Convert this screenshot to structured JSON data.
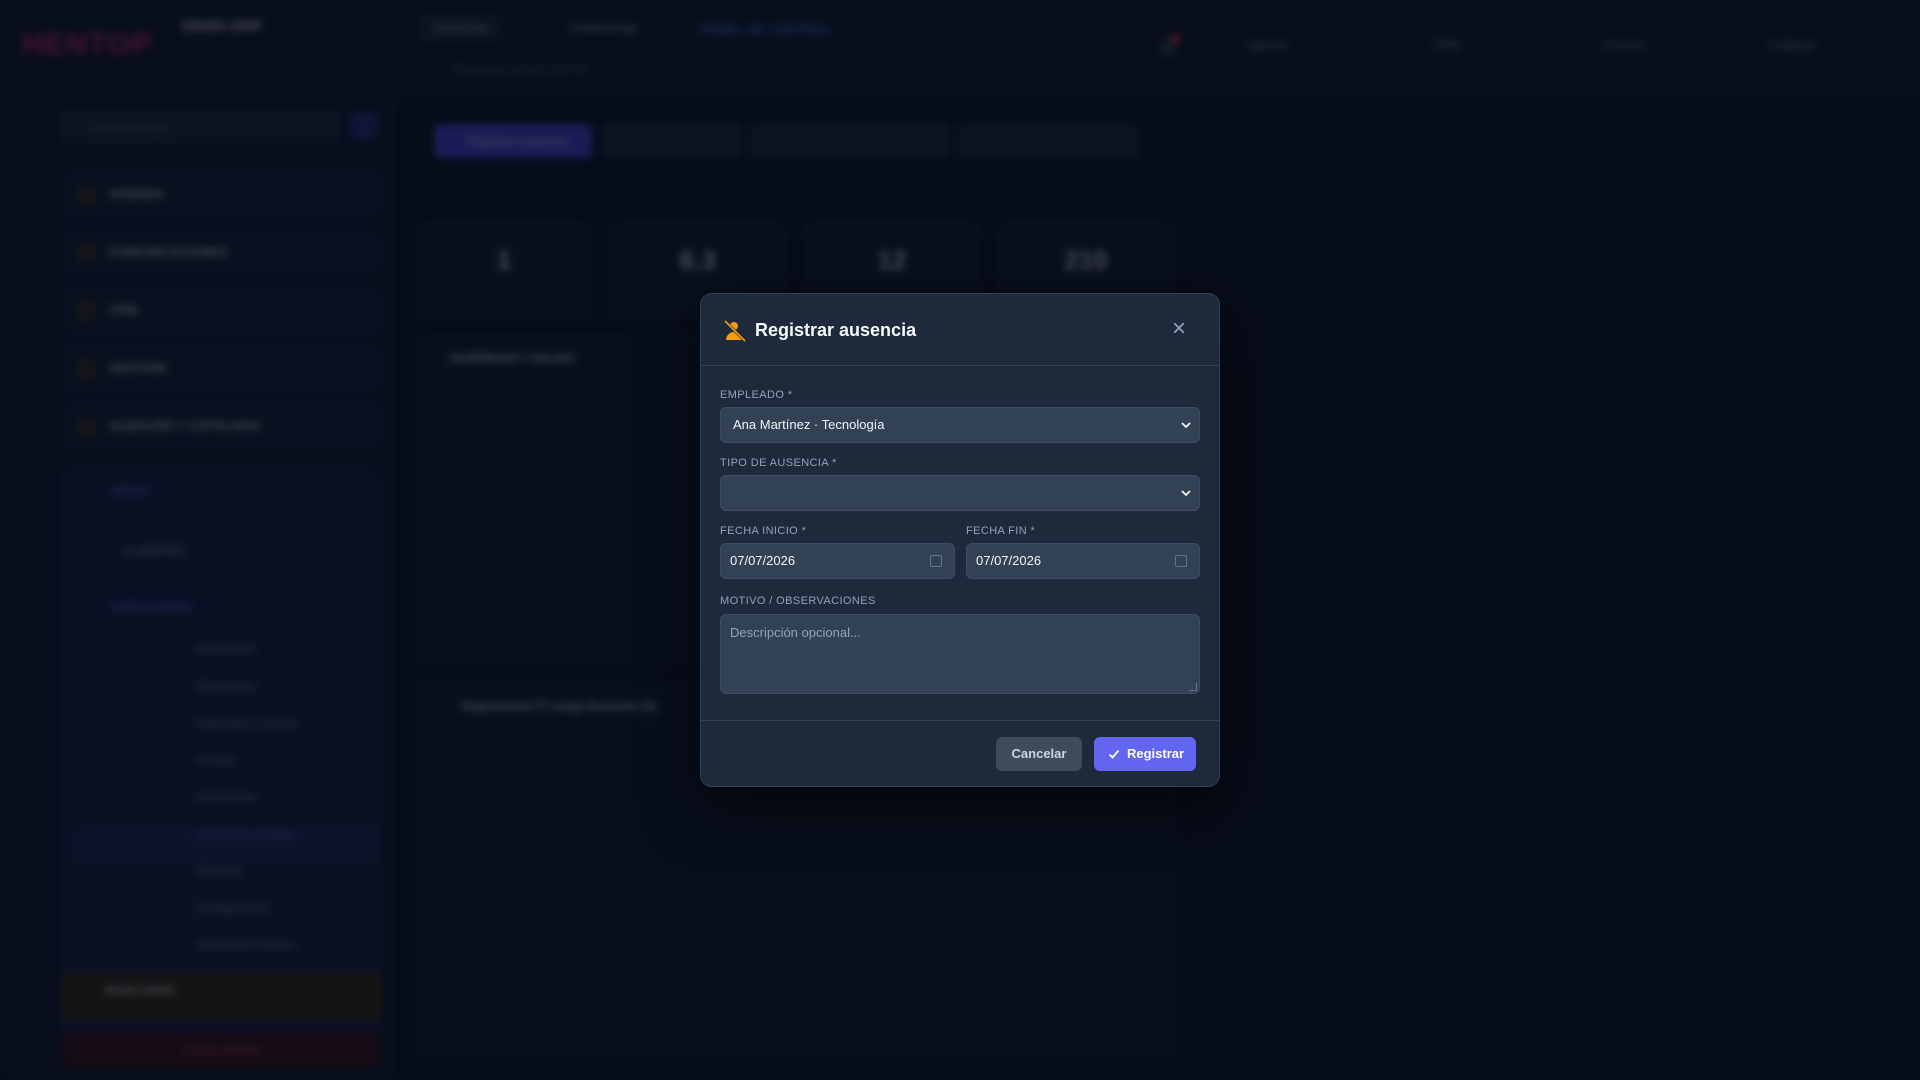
{
  "background": {
    "logo": "HENTOP",
    "brand_name": "DEMO ERP",
    "top_tabs": [
      "Ausencias",
      "Preferencias"
    ],
    "search_placeholder": "Búsqueda global (Ctrl+K)",
    "panel_title": "PANEL DE CONTROL",
    "counters": [
      "Agenda",
      "CRM",
      "Gestión",
      "Catálogo"
    ],
    "sidebar_search_placeholder": "Buscar módulo",
    "sidebar_groups": [
      "AGENDA",
      "COMUNICACIONES",
      "CRM",
      "GESTIÓN",
      "ALMACÉN Y CATÁLOGO",
      "RRHH"
    ],
    "sidebar_sub_groups": [
      "CLIENTES",
      "EMPLEADOS"
    ],
    "sidebar_items": [
      "Dashboard",
      "Empleados",
      "Calendario Laboral",
      "Fichaje",
      "Vacaciones",
      "Ausencias y Bajas",
      "Informes",
      "Configuración",
      "Calendario Festivo"
    ],
    "demo_label": "MODO DEMO",
    "logout_label": "Cerrar Sesión",
    "primary_action": "Registrar ausencia",
    "kpis": [
      "1",
      "6.3",
      "12",
      "210"
    ],
    "card_title": "AUSENCIAS Y BAJAS",
    "card2_title": "Seguimiento IT Larga Duración (3)"
  },
  "modal": {
    "title": "Registrar ausencia",
    "title_icon": "user-absence-icon",
    "close_icon": "close-icon",
    "employee": {
      "label": "EMPLEADO *",
      "value": "Ana Martínez · Tecnología"
    },
    "absence_type": {
      "label": "TIPO DE AUSENCIA *",
      "value": ""
    },
    "start_date": {
      "label": "FECHA INICIO *",
      "value": "07/07/2026"
    },
    "end_date": {
      "label": "FECHA FIN *",
      "value": "07/07/2026"
    },
    "notes": {
      "label": "MOTIVO / OBSERVACIONES",
      "placeholder": "Descripción opcional..."
    },
    "cancel_label": "Cancelar",
    "submit_label": "Registrar"
  },
  "colors": {
    "accent": "#6366f1",
    "modal_bg": "#1e293b",
    "field_bg": "#334155",
    "title_icon": "#f59e0b"
  }
}
